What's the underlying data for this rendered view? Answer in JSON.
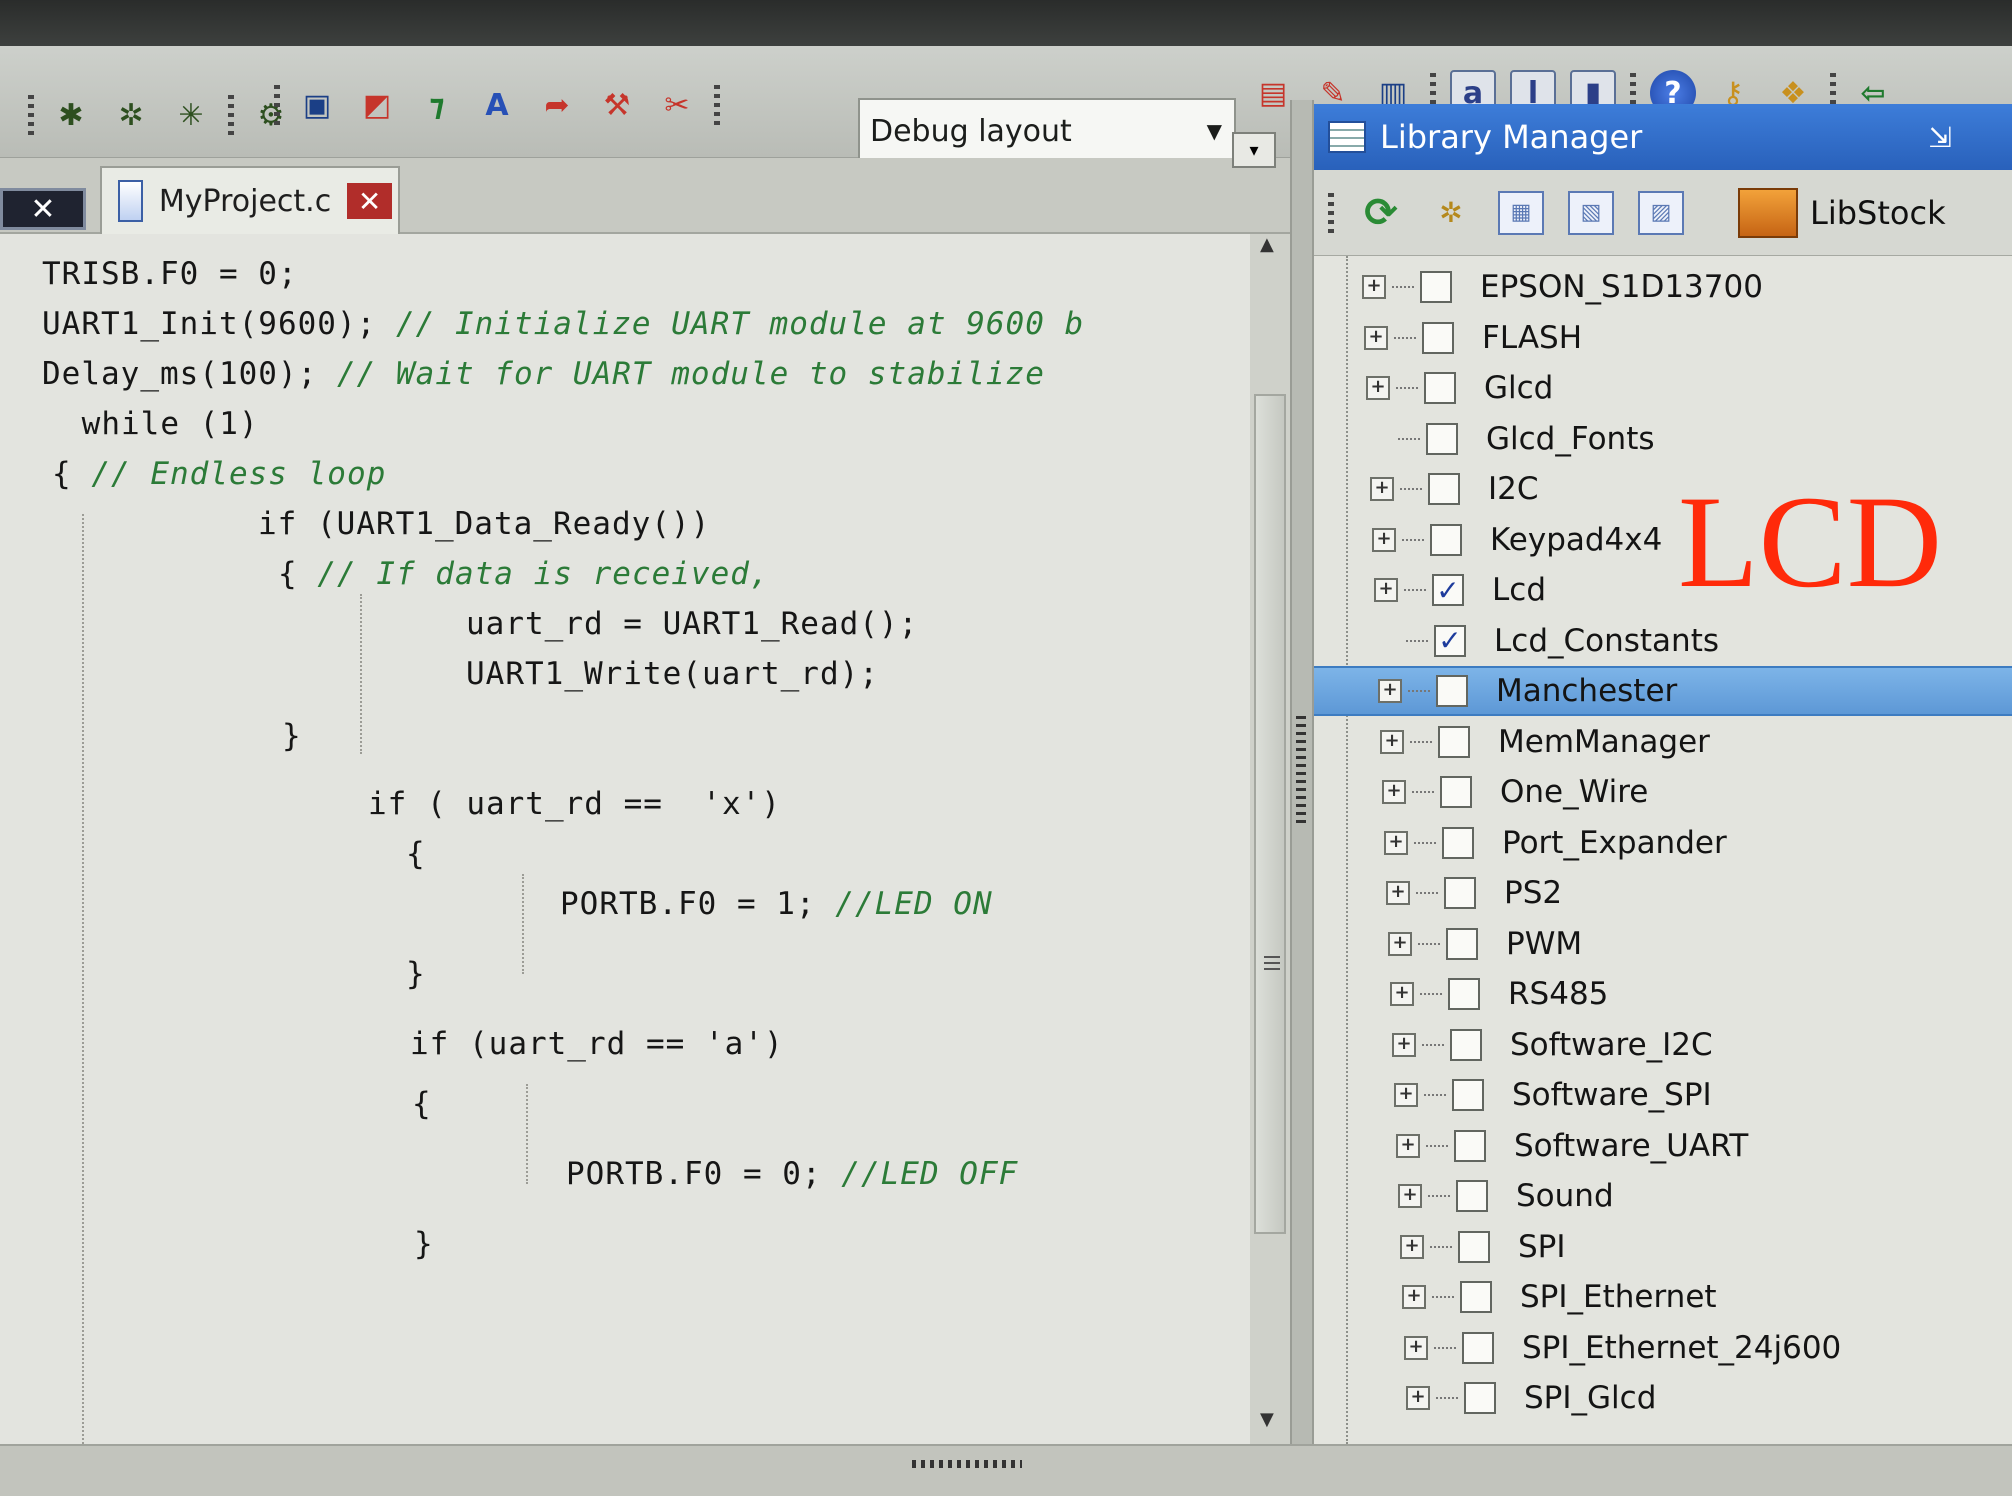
{
  "toolbar": {
    "layout_dropdown": "Debug layout"
  },
  "editor": {
    "tab_label": "MyProject.c",
    "code_lines": [
      {
        "code": "TRISB.F0 = 0;",
        "comment": ""
      },
      {
        "code": "UART1_Init(9600); ",
        "comment": "// Initialize UART module at 9600 b"
      },
      {
        "code": "Delay_ms(100); ",
        "comment": "// Wait for UART module to stabilize"
      },
      {
        "code": " while (1)",
        "comment": ""
      },
      {
        "code": "{ ",
        "comment": "// Endless loop"
      },
      {
        "code": "if (UART1_Data_Ready())",
        "comment": ""
      },
      {
        "code": "{ ",
        "comment": "// If data is received,"
      },
      {
        "code": "uart_rd = UART1_Read();",
        "comment": ""
      },
      {
        "code": "UART1_Write(uart_rd);",
        "comment": ""
      },
      {
        "code": "}",
        "comment": ""
      },
      {
        "code": "if ( uart_rd ==  'x')",
        "comment": ""
      },
      {
        "code": "{",
        "comment": ""
      },
      {
        "code": "PORTB.F0 = 1; ",
        "comment": "//LED ON"
      },
      {
        "code": "}",
        "comment": ""
      },
      {
        "code": "if (uart_rd == 'a')",
        "comment": ""
      },
      {
        "code": "{",
        "comment": ""
      },
      {
        "code": "PORTB.F0 = 0; ",
        "comment": "//LED OFF"
      },
      {
        "code": "}",
        "comment": ""
      }
    ]
  },
  "library_manager": {
    "title": "Library Manager",
    "libstock_label": "LibStock",
    "items": [
      {
        "label": "EPSON_S1D13700",
        "checked": false,
        "expandable": true,
        "selected": false
      },
      {
        "label": "FLASH",
        "checked": false,
        "expandable": true,
        "selected": false
      },
      {
        "label": "Glcd",
        "checked": false,
        "expandable": true,
        "selected": false
      },
      {
        "label": "Glcd_Fonts",
        "checked": false,
        "expandable": false,
        "selected": false
      },
      {
        "label": "I2C",
        "checked": false,
        "expandable": true,
        "selected": false
      },
      {
        "label": "Keypad4x4",
        "checked": false,
        "expandable": true,
        "selected": false
      },
      {
        "label": "Lcd",
        "checked": true,
        "expandable": true,
        "selected": false
      },
      {
        "label": "Lcd_Constants",
        "checked": true,
        "expandable": false,
        "selected": false
      },
      {
        "label": "Manchester",
        "checked": false,
        "expandable": true,
        "selected": true
      },
      {
        "label": "MemManager",
        "checked": false,
        "expandable": true,
        "selected": false
      },
      {
        "label": "One_Wire",
        "checked": false,
        "expandable": true,
        "selected": false
      },
      {
        "label": "Port_Expander",
        "checked": false,
        "expandable": true,
        "selected": false
      },
      {
        "label": "PS2",
        "checked": false,
        "expandable": true,
        "selected": false
      },
      {
        "label": "PWM",
        "checked": false,
        "expandable": true,
        "selected": false
      },
      {
        "label": "RS485",
        "checked": false,
        "expandable": true,
        "selected": false
      },
      {
        "label": "Software_I2C",
        "checked": false,
        "expandable": true,
        "selected": false
      },
      {
        "label": "Software_SPI",
        "checked": false,
        "expandable": true,
        "selected": false
      },
      {
        "label": "Software_UART",
        "checked": false,
        "expandable": true,
        "selected": false
      },
      {
        "label": "Sound",
        "checked": false,
        "expandable": true,
        "selected": false
      },
      {
        "label": "SPI",
        "checked": false,
        "expandable": true,
        "selected": false
      },
      {
        "label": "SPI_Ethernet",
        "checked": false,
        "expandable": true,
        "selected": false
      },
      {
        "label": "SPI_Ethernet_24j600",
        "checked": false,
        "expandable": true,
        "selected": false
      },
      {
        "label": "SPI_Glcd",
        "checked": false,
        "expandable": true,
        "selected": false
      }
    ]
  },
  "annotation": {
    "text": "LCD",
    "color": "#ff2a0a"
  },
  "colors": {
    "selection": "#5d98d6",
    "comment": "#2c7b38",
    "panel_header": "#2961bb"
  }
}
